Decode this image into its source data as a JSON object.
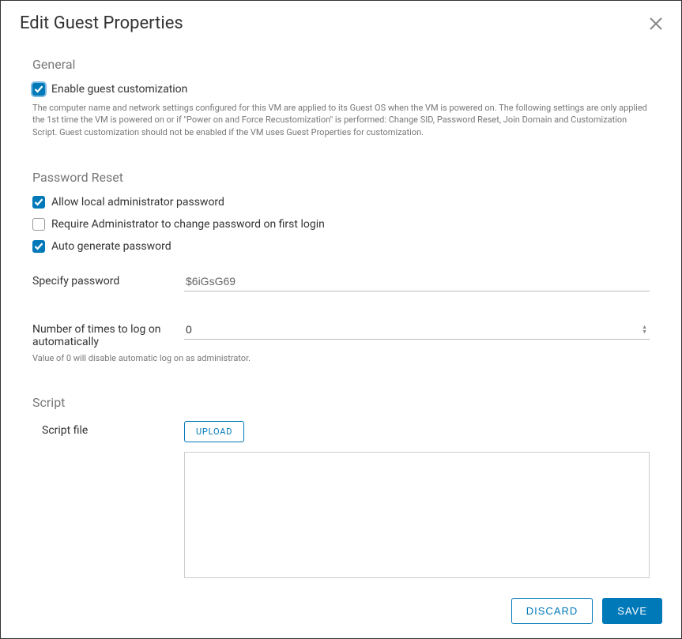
{
  "dialog": {
    "title": "Edit Guest Properties"
  },
  "general": {
    "heading": "General",
    "enable_label": "Enable guest customization",
    "enable_checked": true,
    "helper": "The computer name and network settings configured for this VM are applied to its Guest OS when the VM is powered on. The following settings are only applied the 1st time the VM is powered on or if \"Power on and Force Recustomization\" is performed: Change SID, Password Reset, Join Domain and Customization Script. Guest customization should not be enabled if the VM uses Guest Properties for customization."
  },
  "password_reset": {
    "heading": "Password Reset",
    "allow_label": "Allow local administrator password",
    "allow_checked": true,
    "require_change_label": "Require Administrator to change password on first login",
    "require_change_checked": false,
    "auto_generate_label": "Auto generate password",
    "auto_generate_checked": true,
    "specify_label": "Specify password",
    "specify_value": "$6iGsG69",
    "logon_label": "Number of times to log on automatically",
    "logon_value": "0",
    "logon_hint": "Value of 0 will disable automatic log on as administrator."
  },
  "script": {
    "heading": "Script",
    "file_label": "Script file",
    "upload_label": "UPLOAD",
    "content": ""
  },
  "footer": {
    "discard": "DISCARD",
    "save": "SAVE"
  }
}
